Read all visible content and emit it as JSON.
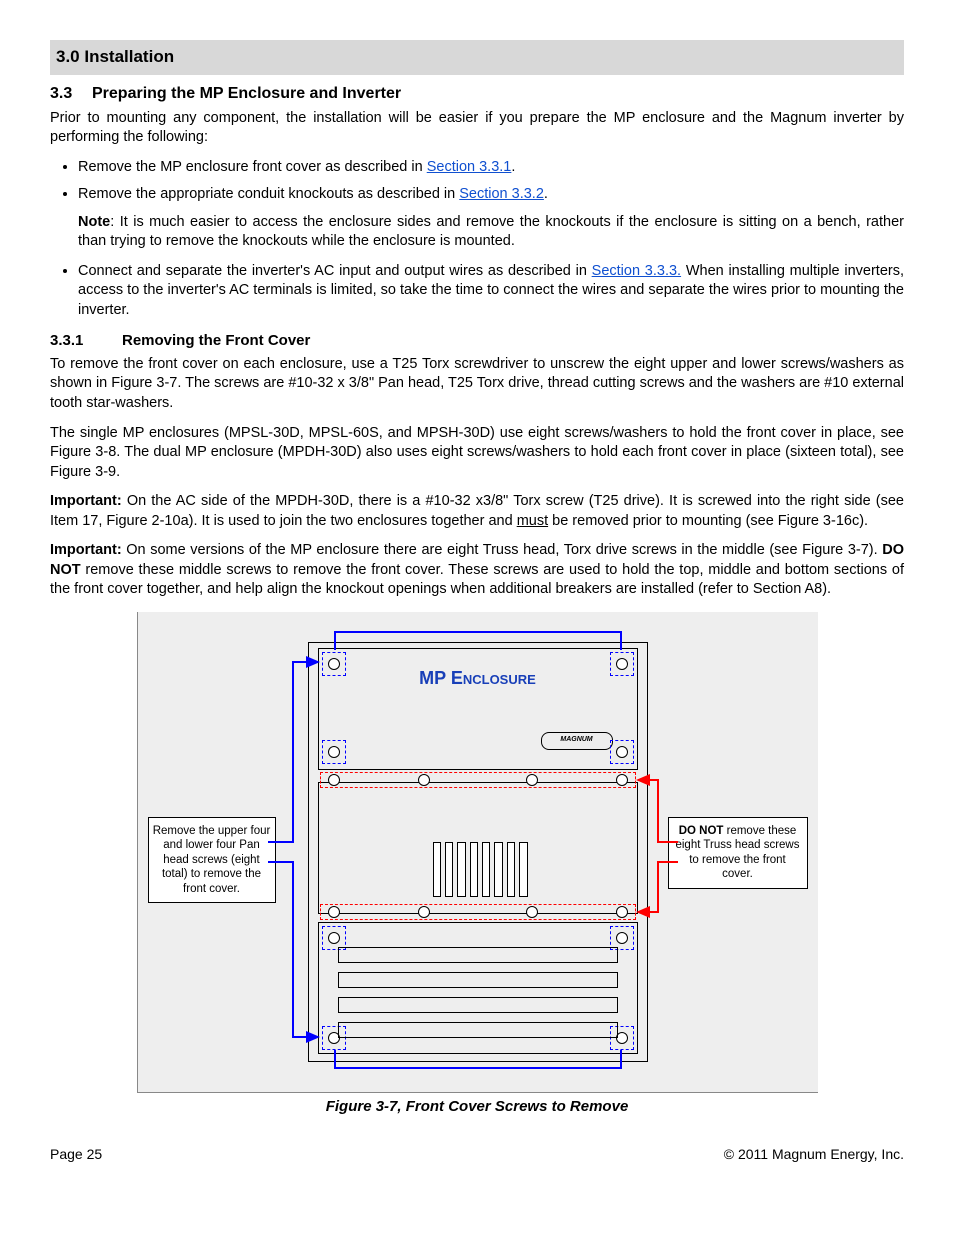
{
  "header": {
    "chapter": "3.0 Installation"
  },
  "section": {
    "num": "3.3",
    "title": "Preparing the MP Enclosure and Inverter",
    "intro": "Prior to mounting any component, the installation will be easier if you prepare the MP enclosure and the Magnum inverter by performing the following:"
  },
  "bullets": {
    "b1_a": "Remove the MP enclosure front cover as described in ",
    "b1_link": "Section 3.3.1",
    "b1_b": ".",
    "b2_a": "Remove the appropriate conduit knockouts as described in ",
    "b2_link": "Section 3.3.2",
    "b2_b": ".",
    "note_label": "Note",
    "note_text": ": It is much easier to access the enclosure sides and remove the knockouts if the enclosure is sitting on a bench, rather than trying to remove the knockouts while the enclosure is mounted.",
    "b3_a": "Connect and separate the inverter's AC input and output wires as described in ",
    "b3_link": "Section 3.3.3.",
    "b3_b": " When installing multiple inverters, access to the inverter's AC terminals is limited, so take the time to connect the wires and separate the wires prior to mounting the inverter."
  },
  "subsection": {
    "num": "3.3.1",
    "title": "Removing the Front Cover",
    "p1": "To remove the front cover on each enclosure, use a T25 Torx screwdriver to unscrew the eight upper and lower screws/washers as shown in Figure 3-7. The screws are #10-32 x 3/8\" Pan head, T25 Torx drive, thread cutting screws and the washers are #10 external tooth star-washers.",
    "p2": "The single MP enclosures (MPSL-30D, MPSL-60S, and MPSH-30D) use eight screws/washers to hold the front cover in place, see Figure 3-8. The dual MP enclosure (MPDH-30D) also uses eight screws/washers to hold each front cover in place (sixteen total), see Figure 3-9.",
    "imp1_label": "Important:",
    "imp1_a": " On the AC side of the MPDH-30D, there is a #10-32 x3/8\" Torx screw (T25 drive). It is screwed into the right side (see Item 17, Figure 2-10a).  It is used to join the two enclosures together and ",
    "imp1_u": "must",
    "imp1_b": " be removed prior to mounting (see Figure 3-16c).",
    "imp2_label": "Important:",
    "imp2_a": " On some versions of the MP enclosure there are eight Truss head, Torx drive screws in the middle (see Figure 3-7). ",
    "imp2_bold": "DO NOT",
    "imp2_b": " remove these middle screws to remove the front cover. These screws are used to hold the top, middle and bottom sections of the front cover together, and help align the knockout openings when additional breakers are installed (refer to Section A8)."
  },
  "figure": {
    "device_title": "MP Enclosure",
    "badge": "MAGNUM",
    "callout_left": "Remove the upper four and lower four Pan head screws (eight total) to remove the front cover.",
    "callout_right_bold": "DO NOT",
    "callout_right_rest": " remove these eight Truss head screws to remove the front cover.",
    "caption": "Figure 3-7, Front Cover Screws to Remove"
  },
  "footer": {
    "page": "Page 25",
    "copyright": "© 2011 Magnum Energy, Inc."
  }
}
